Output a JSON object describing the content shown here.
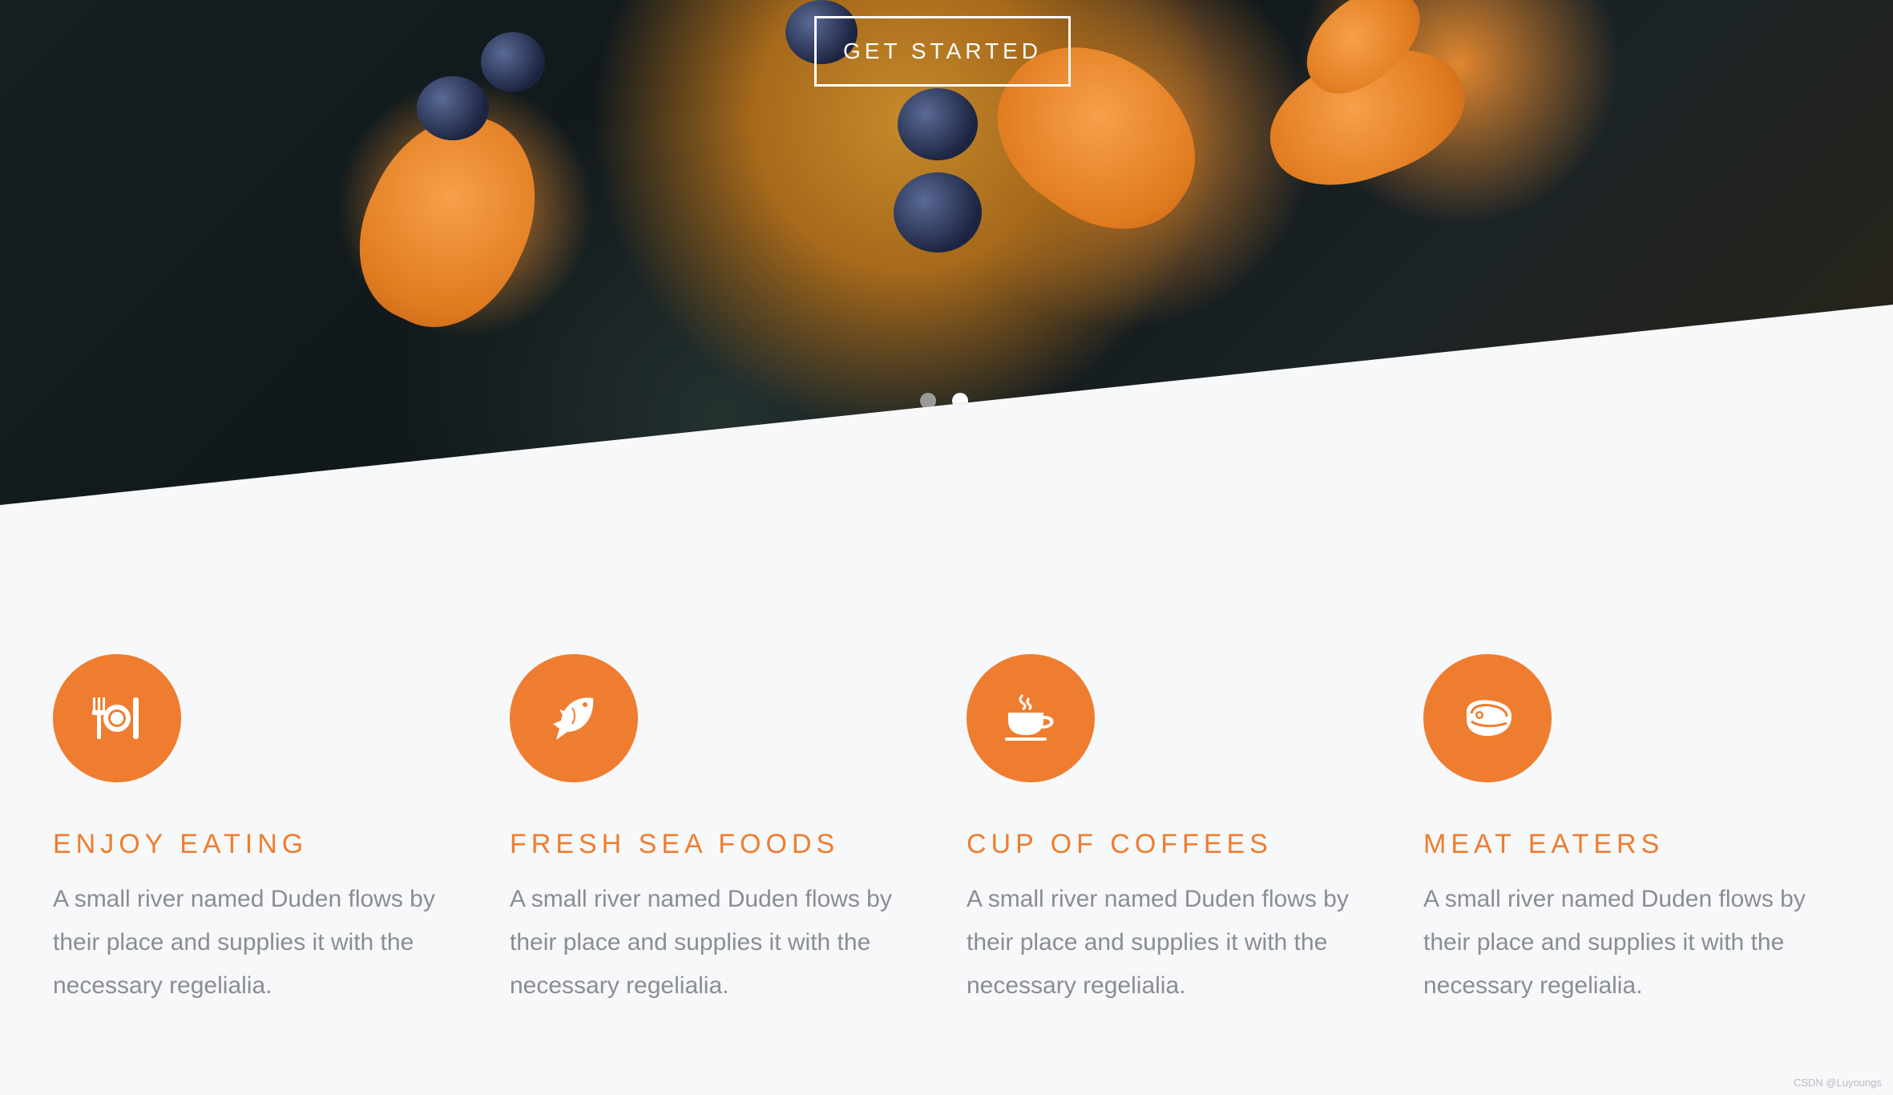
{
  "hero": {
    "cta_label": "GET STARTED",
    "slider": {
      "total": 2,
      "active": 2
    }
  },
  "features": [
    {
      "icon": "dining-plate-icon",
      "title": "ENJOY EATING",
      "text": "A small river named Duden flows by their place and supplies it with the necessary regelialia."
    },
    {
      "icon": "fish-icon",
      "title": "FRESH SEA FOODS",
      "text": "A small river named Duden flows by their place and supplies it with the necessary regelialia."
    },
    {
      "icon": "coffee-cup-icon",
      "title": "CUP OF COFFEES",
      "text": "A small river named Duden flows by their place and supplies it with the necessary regelialia."
    },
    {
      "icon": "steak-icon",
      "title": "MEAT EATERS",
      "text": "A small river named Duden flows by their place and supplies it with the necessary regelialia."
    }
  ],
  "colors": {
    "accent": "#ef7d2f",
    "body_text": "#8a8d92",
    "background": "#f7f8fa"
  },
  "credit": "CSDN @Luyoungs"
}
